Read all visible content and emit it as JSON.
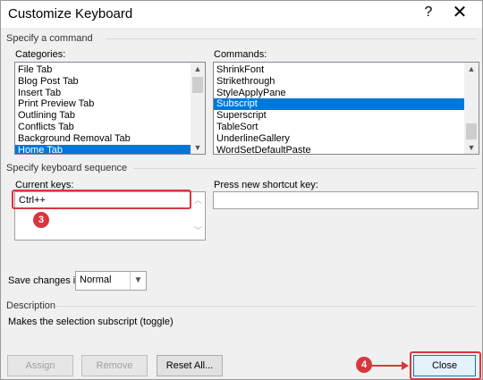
{
  "window": {
    "title": "Customize Keyboard",
    "help": "?",
    "close": "✕"
  },
  "specify_command": {
    "section": "Specify a command",
    "categories_label": "Categories:",
    "categories": [
      "File Tab",
      "Blog Post Tab",
      "Insert Tab",
      "Print Preview Tab",
      "Outlining Tab",
      "Conflicts Tab",
      "Background Removal Tab",
      "Home Tab"
    ],
    "commands_label": "Commands:",
    "commands": [
      "ShrinkFont",
      "Strikethrough",
      "StyleApplyPane",
      "Subscript",
      "Superscript",
      "TableSort",
      "UnderlineGallery",
      "WordSetDefaultPaste"
    ]
  },
  "keyboard_sequence": {
    "section": "Specify keyboard sequence",
    "current_label": "Current keys:",
    "current_value": "Ctrl++",
    "new_label": "Press new shortcut key:",
    "new_value": ""
  },
  "save_changes": {
    "label": "Save changes in:",
    "value": "Normal"
  },
  "description": {
    "section": "Description",
    "text": "Makes the selection subscript (toggle)"
  },
  "buttons": {
    "assign": "Assign",
    "remove": "Remove",
    "reset": "Reset All...",
    "close": "Close"
  },
  "annotations": {
    "step3": "3",
    "step4": "4",
    "accent": "#d9363e"
  }
}
